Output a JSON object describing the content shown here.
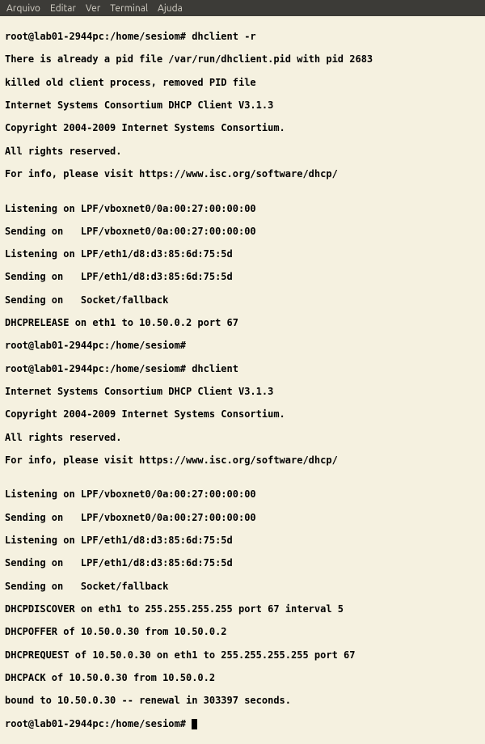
{
  "menubar": {
    "items": [
      "Arquivo",
      "Editar",
      "Ver",
      "Terminal",
      "Ajuda"
    ]
  },
  "terminal": {
    "lines": [
      "root@lab01-2944pc:/home/sesiom# dhclient -r",
      "There is already a pid file /var/run/dhclient.pid with pid 2683",
      "killed old client process, removed PID file",
      "Internet Systems Consortium DHCP Client V3.1.3",
      "Copyright 2004-2009 Internet Systems Consortium.",
      "All rights reserved.",
      "For info, please visit https://www.isc.org/software/dhcp/",
      "",
      "Listening on LPF/vboxnet0/0a:00:27:00:00:00",
      "Sending on   LPF/vboxnet0/0a:00:27:00:00:00",
      "Listening on LPF/eth1/d8:d3:85:6d:75:5d",
      "Sending on   LPF/eth1/d8:d3:85:6d:75:5d",
      "Sending on   Socket/fallback",
      "DHCPRELEASE on eth1 to 10.50.0.2 port 67",
      "root@lab01-2944pc:/home/sesiom# ",
      "root@lab01-2944pc:/home/sesiom# dhclient",
      "Internet Systems Consortium DHCP Client V3.1.3",
      "Copyright 2004-2009 Internet Systems Consortium.",
      "All rights reserved.",
      "For info, please visit https://www.isc.org/software/dhcp/",
      "",
      "Listening on LPF/vboxnet0/0a:00:27:00:00:00",
      "Sending on   LPF/vboxnet0/0a:00:27:00:00:00",
      "Listening on LPF/eth1/d8:d3:85:6d:75:5d",
      "Sending on   LPF/eth1/d8:d3:85:6d:75:5d",
      "Sending on   Socket/fallback",
      "DHCPDISCOVER on eth1 to 255.255.255.255 port 67 interval 5",
      "DHCPOFFER of 10.50.0.30 from 10.50.0.2",
      "DHCPREQUEST of 10.50.0.30 on eth1 to 255.255.255.255 port 67",
      "DHCPACK of 10.50.0.30 from 10.50.0.2",
      "bound to 10.50.0.30 -- renewal in 303397 seconds."
    ],
    "prompt_last": "root@lab01-2944pc:/home/sesiom# "
  }
}
